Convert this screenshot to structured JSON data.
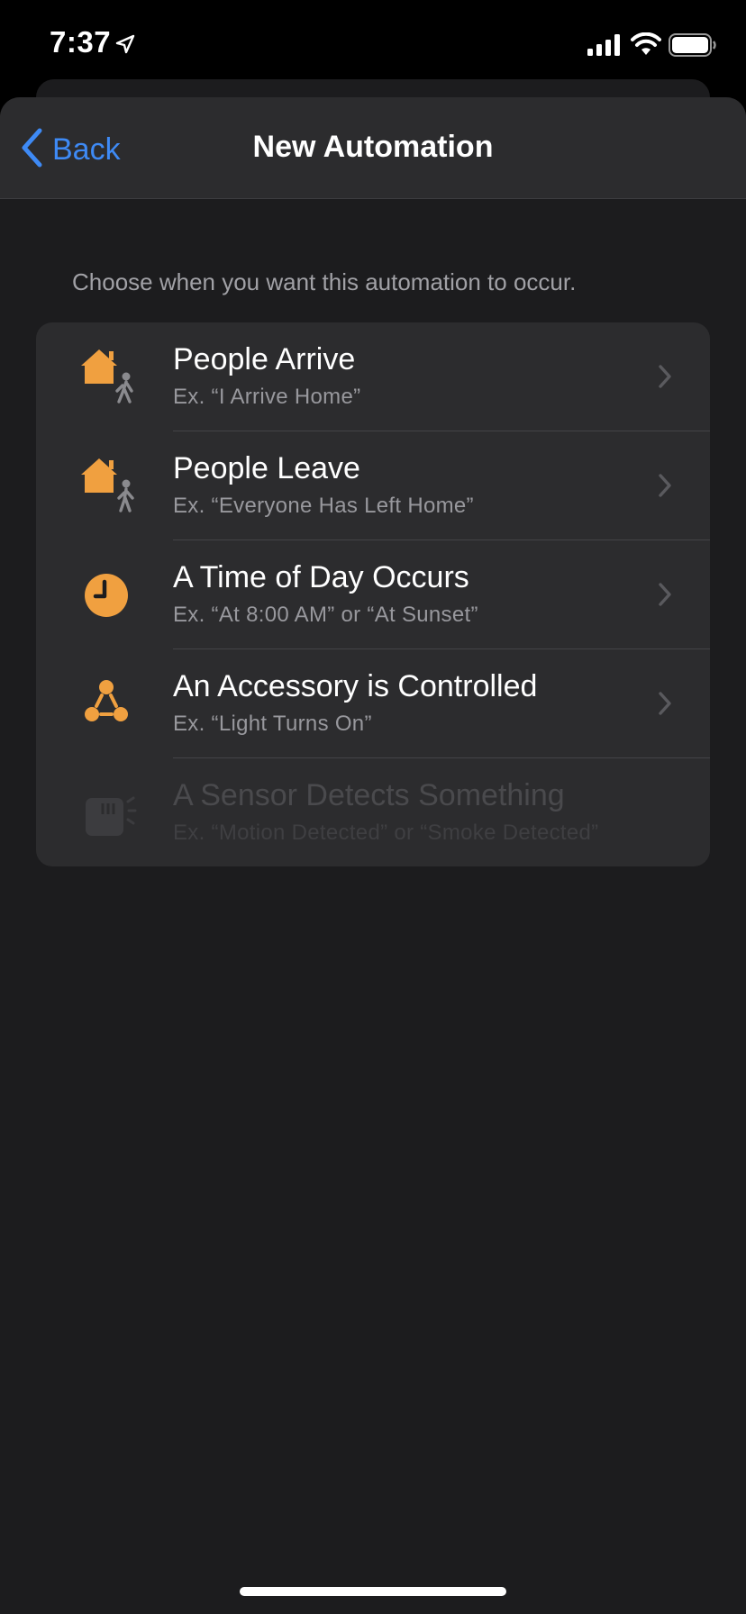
{
  "status_bar": {
    "time": "7:37",
    "location_icon": "location-arrow-icon",
    "signal_icon": "cellular-signal-icon",
    "wifi_icon": "wifi-icon",
    "battery_icon": "battery-full-icon"
  },
  "nav": {
    "back_label": "Back",
    "title": "New Automation"
  },
  "prompt": "Choose when you want this automation to occur.",
  "options": [
    {
      "title": "People Arrive",
      "subtitle": "Ex. “I Arrive Home”",
      "icon": "house-person-arrive-icon",
      "enabled": true
    },
    {
      "title": "People Leave",
      "subtitle": "Ex. “Everyone Has Left Home”",
      "icon": "house-person-leave-icon",
      "enabled": true
    },
    {
      "title": "A Time of Day Occurs",
      "subtitle": "Ex. “At 8:00 AM” or “At Sunset”",
      "icon": "clock-icon",
      "enabled": true
    },
    {
      "title": "An Accessory is Controlled",
      "subtitle": "Ex. “Light Turns On”",
      "icon": "accessory-network-icon",
      "enabled": true
    },
    {
      "title": "A Sensor Detects Something",
      "subtitle": "Ex. “Motion Detected” or “Smoke Detected”",
      "icon": "sensor-icon",
      "enabled": false
    }
  ],
  "colors": {
    "accent": "#3e8af5",
    "icon_orange": "#f0a040",
    "background": "#1c1c1e",
    "card": "#2c2c2e"
  }
}
